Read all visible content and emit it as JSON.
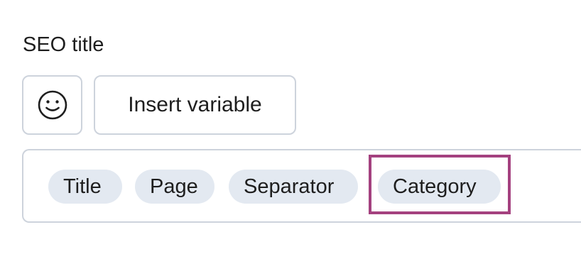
{
  "field": {
    "label": "SEO title"
  },
  "toolbar": {
    "emoji_icon": "smiley-face-icon",
    "insert_variable_label": "Insert variable"
  },
  "editor": {
    "chips": [
      {
        "label": "Title"
      },
      {
        "label": "Page"
      },
      {
        "label": "Separator"
      },
      {
        "label": "Category"
      }
    ]
  },
  "colors": {
    "chip_background": "#e3e9f1",
    "border": "#cdd3dc",
    "highlight": "#a4417f",
    "text": "#1e1e1e"
  }
}
